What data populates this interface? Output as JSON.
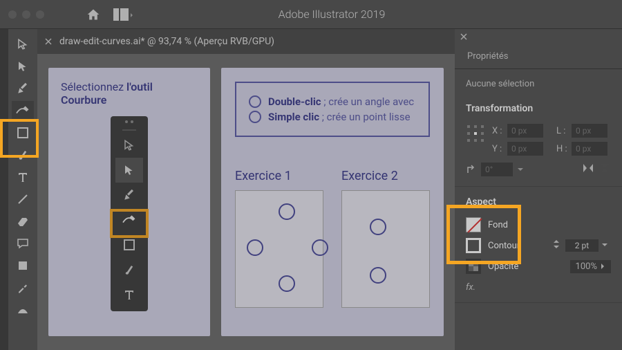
{
  "app_title": "Adobe Illustrator 2019",
  "tab_name": "draw-edit-curves.ai* @ 93,74 % (Aperçu RVB/GPU)",
  "card_left": {
    "heading_prefix": "Sélectionnez ",
    "heading_strong": "l'outil Courbure"
  },
  "instructions": [
    {
      "bold": "Double-clic",
      "rest": " ; crée un angle avec"
    },
    {
      "bold": "Simple clic",
      "rest": " ; crée un point lisse"
    }
  ],
  "exercises": [
    {
      "title": "Exercice 1"
    },
    {
      "title": "Exercice 2"
    }
  ],
  "panel": {
    "tab": "Propriétés",
    "no_selection": "Aucune sélection",
    "transform": {
      "title": "Transformation",
      "x_label": "X :",
      "x_val": "0 px",
      "y_label": "Y :",
      "y_val": "0 px",
      "l_label": "L :",
      "l_val": "0 px",
      "h_label": "H :",
      "h_val": "0 px",
      "angle": "0°"
    },
    "aspect": {
      "title": "Aspect",
      "fond": "Fond",
      "contour": "Contour",
      "stroke_val": "2 pt",
      "opacity_label": "Opacité",
      "opacity_val": "100%",
      "fx": "fx."
    }
  }
}
